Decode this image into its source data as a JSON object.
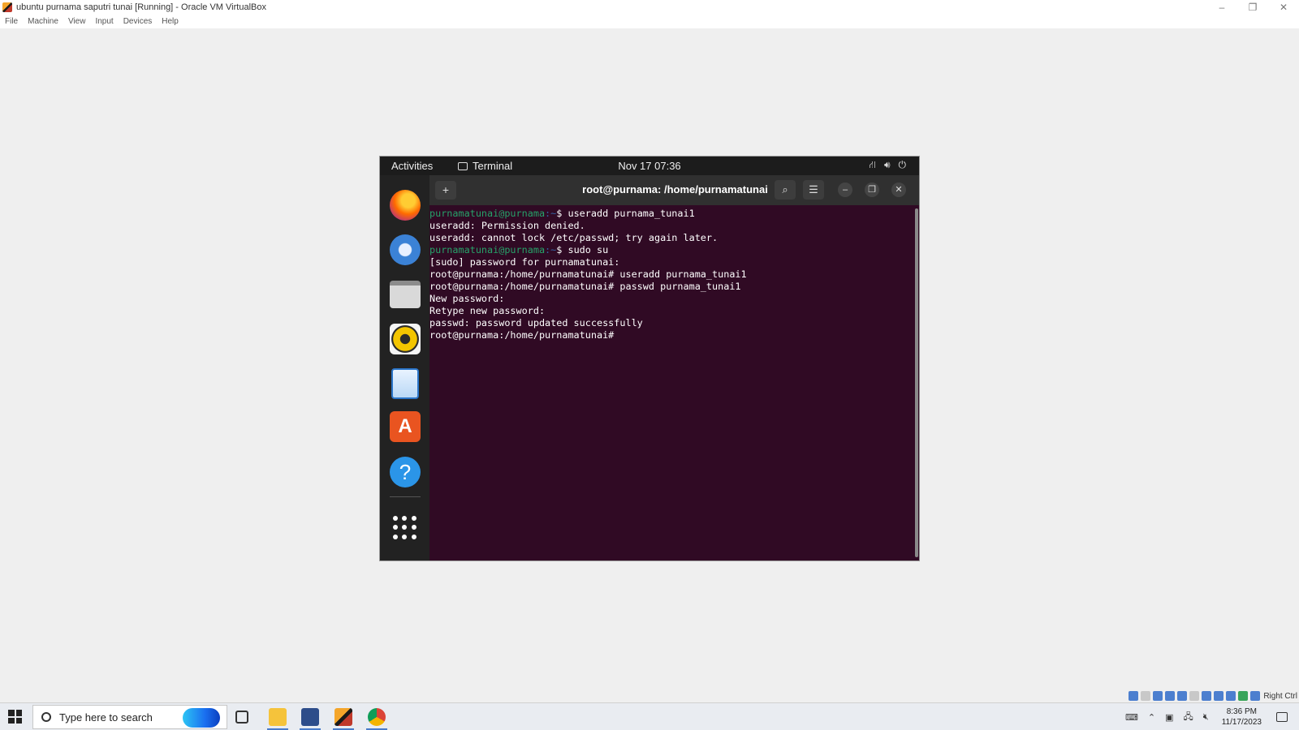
{
  "host_window": {
    "title": "ubuntu purnama saputri tunai [Running] - Oracle VM VirtualBox",
    "controls": {
      "minimize": "–",
      "restore": "❐",
      "close": "✕"
    }
  },
  "menubar": [
    "File",
    "Machine",
    "View",
    "Input",
    "Devices",
    "Help"
  ],
  "guest": {
    "topbar": {
      "activities": "Activities",
      "app_name": "Terminal",
      "clock": "Nov 17  07:36",
      "system_icons": [
        "network-icon",
        "volume-icon",
        "power-icon"
      ]
    },
    "dock_icons": [
      "firefox-icon",
      "thunderbird-icon",
      "files-icon",
      "rhythmbox-icon",
      "libreoffice-writer-icon",
      "ubuntu-software-icon",
      "help-icon",
      "show-apps-icon"
    ],
    "terminal": {
      "title": "root@purnama: /home/purnamatunai",
      "lines": [
        {
          "user": "purnamatunai@purnama",
          "path": ":~",
          "rest": "$ useradd purnama_tunai1"
        },
        {
          "text": "useradd: Permission denied."
        },
        {
          "text": "useradd: cannot lock /etc/passwd; try again later."
        },
        {
          "user": "purnamatunai@purnama",
          "path": ":~",
          "rest": "$ sudo su"
        },
        {
          "text": "[sudo] password for purnamatunai:"
        },
        {
          "text": "root@purnama:/home/purnamatunai# useradd purnama_tunai1"
        },
        {
          "text": "root@purnama:/home/purnamatunai# passwd purnama_tunai1"
        },
        {
          "text": "New password:"
        },
        {
          "text": "Retype new password:"
        },
        {
          "text": "passwd: password updated successfully"
        },
        {
          "text": "root@purnama:/home/purnamatunai# "
        }
      ]
    }
  },
  "statusbar": {
    "host_key": "Right Ctrl"
  },
  "taskbar": {
    "search_placeholder": "Type here to search",
    "time": "8:36 PM",
    "date": "11/17/2023"
  }
}
